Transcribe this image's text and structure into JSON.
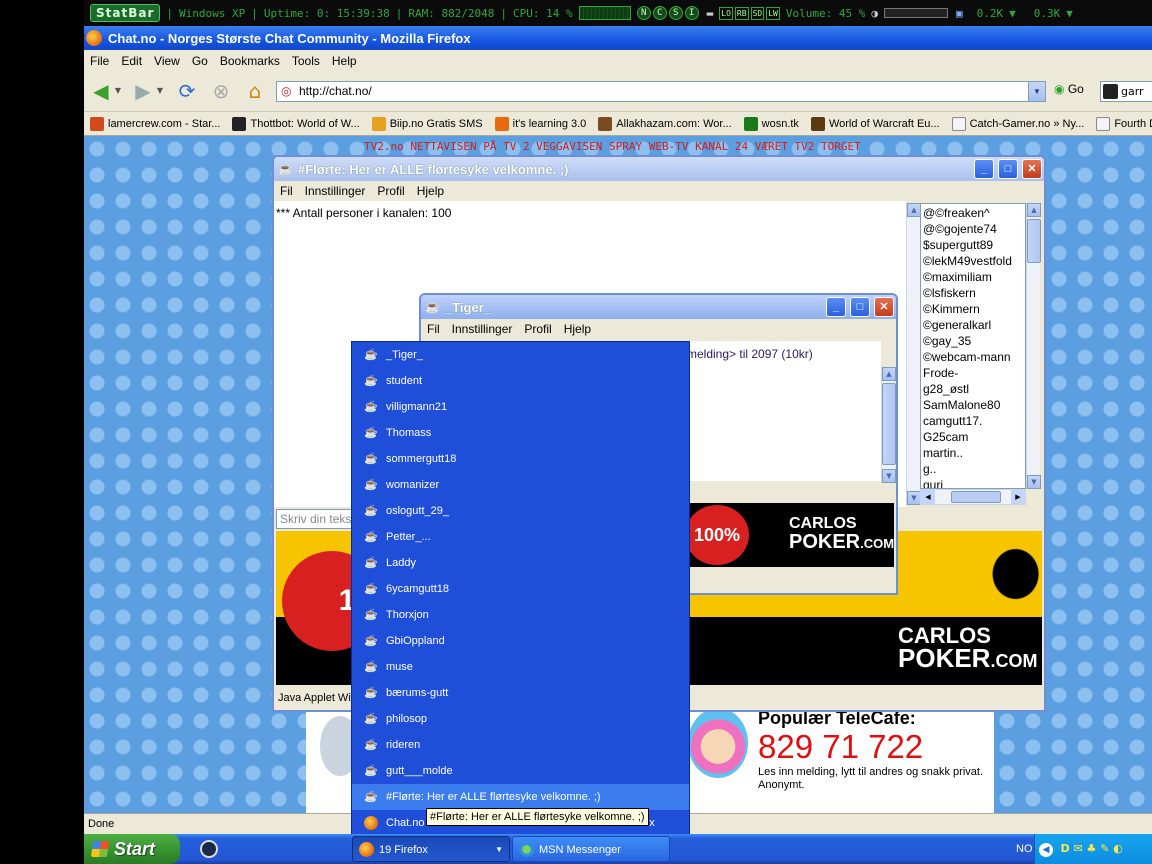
{
  "statbar": {
    "logo": "StatBar",
    "os": "Windows XP",
    "uptime": "Uptime:  0: 15:39:38",
    "ram": "RAM:  882/2048",
    "cpu": "CPU:   14 %",
    "buttons": [
      "N",
      "C",
      "S",
      "I"
    ],
    "drives": [
      "LO",
      "RB",
      "SD",
      "LW"
    ],
    "volume": "Volume:  45 %",
    "net_down": "0.2K",
    "net_up": "0.3K"
  },
  "firefox": {
    "title": "Chat.no - Norges Største Chat Community - Mozilla Firefox",
    "menu": [
      "File",
      "Edit",
      "View",
      "Go",
      "Bookmarks",
      "Tools",
      "Help"
    ],
    "url": "http://chat.no/",
    "go_label": "Go",
    "search_value": "garr",
    "bookmarks": [
      {
        "label": "lamercrew.com - Star...",
        "color": "#d04a1c"
      },
      {
        "label": "Thottbot: World of W...",
        "color": "#222222"
      },
      {
        "label": "Biip.no Gratis SMS",
        "color": "#e8a020"
      },
      {
        "label": "it's learning 3.0",
        "color": "#e86a10"
      },
      {
        "label": "Allakhazam.com: Wor...",
        "color": "#7a4a20"
      },
      {
        "label": "wosn.tk",
        "color": "#1a7a1a"
      },
      {
        "label": "World of Warcraft Eu...",
        "color": "#5a3a10"
      },
      {
        "label": "Catch-Gamer.no » Ny...",
        "color": "#f4f4f4"
      },
      {
        "label": "Fourth Da",
        "color": "#f4f4f4"
      }
    ],
    "status": "Done"
  },
  "page": {
    "tv2_bar": "TV2.no  NETTAVISEN  PÅ TV 2  VEGGAVISEN  SPRAY  WEB-TV  KANAL 24  VÆRET  TV2 TORGET",
    "telecafe_title": "Populær TeleCafe:",
    "telecafe_phone": "829 71 722",
    "telecafe_desc": "Les inn melding, lytt til andres og snakk privat. Anonymt."
  },
  "chat_window": {
    "title": "#Flørte: Her er ALLE flørtesyke velkomne. ;)",
    "menu": [
      "Fil",
      "Innstillinger",
      "Profil",
      "Hjelp"
    ],
    "message": "*** Antall personer i kanalen: 100",
    "input_placeholder": "Skriv din teks",
    "status": "Java Applet Wi",
    "users": [
      "@©freaken^",
      "@©gojente74",
      "$supergutt89",
      "©lekM49vestfold",
      "©maximiliam",
      "©lsfiskern",
      "©Kimmern",
      "©generalkarl",
      "©gay_35",
      "©webcam-mann",
      "Frode-",
      "g28_østl",
      "SamMalone80",
      "camgutt17.",
      "G25cam",
      "martin..",
      "g..",
      "guri"
    ]
  },
  "tiger_window": {
    "title": "_Tiger_",
    "menu": [
      "Fil",
      "Innstillinger",
      "Profil",
      "Hjelp"
    ],
    "message": "melding> til 2097 (10kr)"
  },
  "ads": {
    "brand_top": "CARLOS",
    "brand_bottom": "POKER",
    "brand_suffix": ".COM",
    "badge": "100%",
    "badge_partial": "10"
  },
  "taskbar_popup": {
    "items": [
      "_Tiger_",
      "student",
      "villigmann21",
      "Thomass",
      "sommergutt18",
      "womanizer",
      "oslogutt_29_",
      "Petter_...",
      "Laddy",
      "6ycamgutt18",
      "Thorxjon",
      "GbiOppland",
      "muse",
      "bærums-gutt",
      "philosop",
      "rideren",
      "gutt___molde",
      "#Flørte: Her er ALLE flørtesyke velkomne. ;)",
      "Chat.no"
    ],
    "highlighted_index": 17,
    "tooltip": "#Flørte: Her er ALLE flørtesyke velkomne. ;)",
    "last_item_suffix": "efox"
  },
  "taskbar": {
    "start": "Start",
    "buttons": [
      "19 Firefox",
      "MSN Messenger"
    ],
    "tray_lang": "NO"
  }
}
